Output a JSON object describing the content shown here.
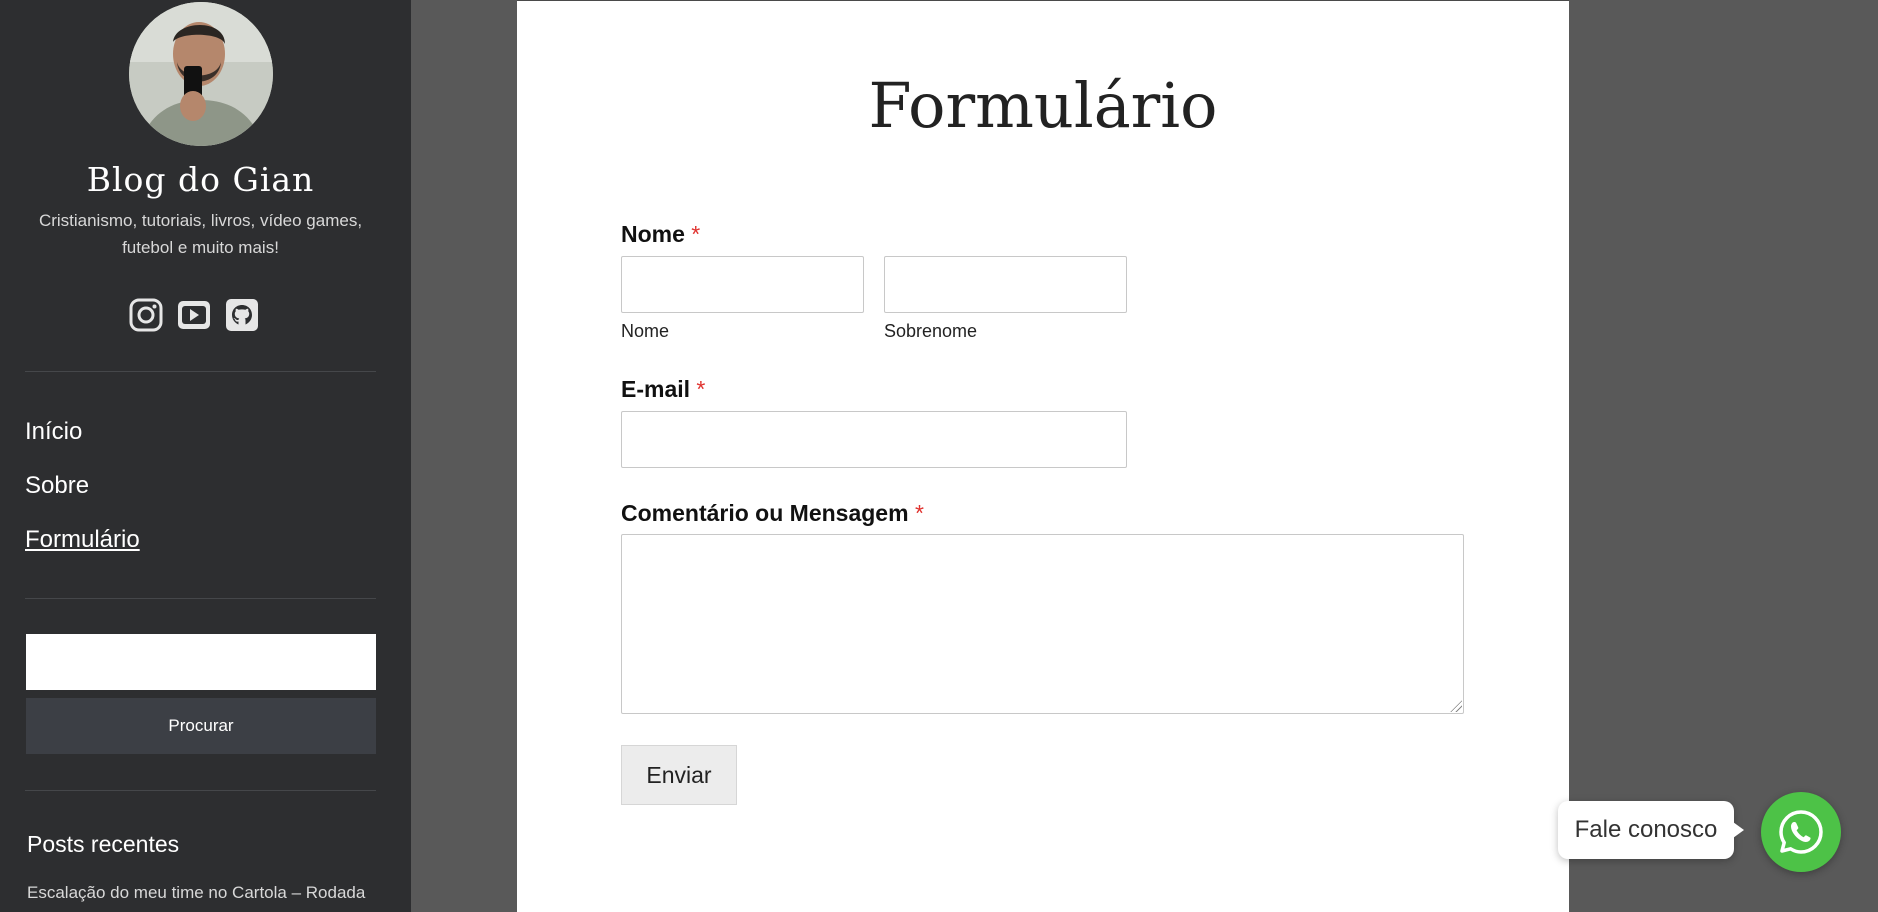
{
  "sidebar": {
    "site_title": "Blog do Gian",
    "site_description": "Cristianismo, tutoriais, livros, vídeo games, futebol e muito mais!",
    "social_icons": [
      "instagram-icon",
      "youtube-icon",
      "github-icon"
    ],
    "nav": [
      {
        "label": "Início",
        "current": false
      },
      {
        "label": "Sobre",
        "current": false
      },
      {
        "label": "Formulário",
        "current": true
      }
    ],
    "search": {
      "value": "",
      "button_label": "Procurar"
    },
    "recent_posts": {
      "title": "Posts recentes",
      "items": [
        "Escalação do meu time no Cartola – Rodada"
      ]
    }
  },
  "main": {
    "page_title": "Formulário",
    "form": {
      "name_label": "Nome",
      "required_marker": "*",
      "first_name_sublabel": "Nome",
      "last_name_sublabel": "Sobrenome",
      "email_label": "E-mail",
      "message_label": "Comentário ou Mensagem",
      "submit_label": "Enviar"
    }
  },
  "whatsapp": {
    "bubble_text": "Fale conosco",
    "icon": "whatsapp-icon",
    "color": "#4dc247"
  },
  "colors": {
    "sidebar_bg": "#2d2e30",
    "page_bg": "#595959",
    "required": "#e0332f"
  }
}
